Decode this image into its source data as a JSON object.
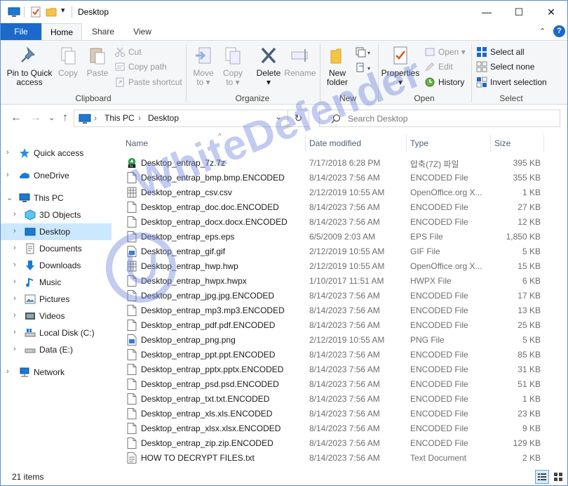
{
  "window": {
    "title": "Desktop",
    "minimize": "—",
    "maximize": "☐",
    "close": "✕"
  },
  "tabs": {
    "file": "File",
    "home": "Home",
    "share": "Share",
    "view": "View",
    "collapse": "⌃",
    "help": "?"
  },
  "ribbon": {
    "clipboard": {
      "label": "Clipboard",
      "pin_line1": "Pin to Quick",
      "pin_line2": "access",
      "copy": "Copy",
      "paste": "Paste",
      "cut": "Cut",
      "copy_path": "Copy path",
      "paste_shortcut": "Paste shortcut"
    },
    "organize": {
      "label": "Organize",
      "move_line1": "Move",
      "move_line2": "to ▾",
      "copy_line1": "Copy",
      "copy_line2": "to ▾",
      "delete_line1": "Delete",
      "delete_line2": "▾",
      "rename": "Rename"
    },
    "new": {
      "label": "New",
      "new_folder_line1": "New",
      "new_folder_line2": "folder"
    },
    "open": {
      "label": "Open",
      "properties_line1": "Properties",
      "properties_line2": "▾",
      "open": "Open ▾",
      "edit": "Edit",
      "history": "History"
    },
    "select": {
      "label": "Select",
      "select_all": "Select all",
      "select_none": "Select none",
      "invert": "Invert selection"
    }
  },
  "address": {
    "back": "←",
    "forward": "→",
    "recent": "⌄",
    "up": "↑",
    "sep1": "›",
    "part1": "This PC",
    "sep2": "›",
    "part2": "Desktop",
    "dropdown": "⌄",
    "refresh": "↻",
    "search_placeholder": "Search Desktop"
  },
  "nav": [
    {
      "label": "Quick access"
    },
    {
      "label": "OneDrive"
    },
    {
      "label": "This PC"
    },
    {
      "label": "3D Objects"
    },
    {
      "label": "Desktop"
    },
    {
      "label": "Documents"
    },
    {
      "label": "Downloads"
    },
    {
      "label": "Music"
    },
    {
      "label": "Pictures"
    },
    {
      "label": "Videos"
    },
    {
      "label": "Local Disk (C:)"
    },
    {
      "label": "Data (E:)"
    },
    {
      "label": "Network"
    }
  ],
  "columns": {
    "name": "Name",
    "date": "Date modified",
    "type": "Type",
    "size": "Size",
    "sort": "^"
  },
  "files": [
    {
      "name": "Desktop_entrap_7z.7z",
      "date": "7/17/2018 6:28 PM",
      "type": "압축(7Z) 파일",
      "size": "395 KB"
    },
    {
      "name": "Desktop_entrap_bmp.bmp.ENCODED",
      "date": "8/14/2023 7:56 AM",
      "type": "ENCODED File",
      "size": "355 KB"
    },
    {
      "name": "Desktop_entrap_csv.csv",
      "date": "2/12/2019 10:55 AM",
      "type": "OpenOffice.org X...",
      "size": "1 KB"
    },
    {
      "name": "Desktop_entrap_doc.doc.ENCODED",
      "date": "8/14/2023 7:56 AM",
      "type": "ENCODED File",
      "size": "27 KB"
    },
    {
      "name": "Desktop_entrap_docx.docx.ENCODED",
      "date": "8/14/2023 7:56 AM",
      "type": "ENCODED File",
      "size": "12 KB"
    },
    {
      "name": "Desktop_entrap_eps.eps",
      "date": "6/5/2009 2:03 AM",
      "type": "EPS File",
      "size": "1,850 KB"
    },
    {
      "name": "Desktop_entrap_gif.gif",
      "date": "2/12/2019 10:55 AM",
      "type": "GIF File",
      "size": "5 KB"
    },
    {
      "name": "Desktop_entrap_hwp.hwp",
      "date": "2/12/2019 10:55 AM",
      "type": "OpenOffice.org X...",
      "size": "15 KB"
    },
    {
      "name": "Desktop_entrap_hwpx.hwpx",
      "date": "1/10/2017 11:51 AM",
      "type": "HWPX File",
      "size": "6 KB"
    },
    {
      "name": "Desktop_entrap_jpg.jpg.ENCODED",
      "date": "8/14/2023 7:56 AM",
      "type": "ENCODED File",
      "size": "17 KB"
    },
    {
      "name": "Desktop_entrap_mp3.mp3.ENCODED",
      "date": "8/14/2023 7:56 AM",
      "type": "ENCODED File",
      "size": "13 KB"
    },
    {
      "name": "Desktop_entrap_pdf.pdf.ENCODED",
      "date": "8/14/2023 7:56 AM",
      "type": "ENCODED File",
      "size": "25 KB"
    },
    {
      "name": "Desktop_entrap_png.png",
      "date": "2/12/2019 10:55 AM",
      "type": "PNG File",
      "size": "5 KB"
    },
    {
      "name": "Desktop_entrap_ppt.ppt.ENCODED",
      "date": "8/14/2023 7:56 AM",
      "type": "ENCODED File",
      "size": "85 KB"
    },
    {
      "name": "Desktop_entrap_pptx.pptx.ENCODED",
      "date": "8/14/2023 7:56 AM",
      "type": "ENCODED File",
      "size": "31 KB"
    },
    {
      "name": "Desktop_entrap_psd.psd.ENCODED",
      "date": "8/14/2023 7:56 AM",
      "type": "ENCODED File",
      "size": "51 KB"
    },
    {
      "name": "Desktop_entrap_txt.txt.ENCODED",
      "date": "8/14/2023 7:56 AM",
      "type": "ENCODED File",
      "size": "1 KB"
    },
    {
      "name": "Desktop_entrap_xls.xls.ENCODED",
      "date": "8/14/2023 7:56 AM",
      "type": "ENCODED File",
      "size": "23 KB"
    },
    {
      "name": "Desktop_entrap_xlsx.xlsx.ENCODED",
      "date": "8/14/2023 7:56 AM",
      "type": "ENCODED File",
      "size": "9 KB"
    },
    {
      "name": "Desktop_entrap_zip.zip.ENCODED",
      "date": "8/14/2023 7:56 AM",
      "type": "ENCODED File",
      "size": "129 KB"
    },
    {
      "name": "HOW TO DECRYPT FILES.txt",
      "date": "8/14/2023 7:56 AM",
      "type": "Text Document",
      "size": "2 KB"
    }
  ],
  "status": {
    "items": "21 items"
  },
  "watermark": {
    "text": "WhiteDefender"
  },
  "colors": {
    "accent": "#1b6ac9",
    "selection": "#cce8ff",
    "watermark": "#6e82dc"
  }
}
